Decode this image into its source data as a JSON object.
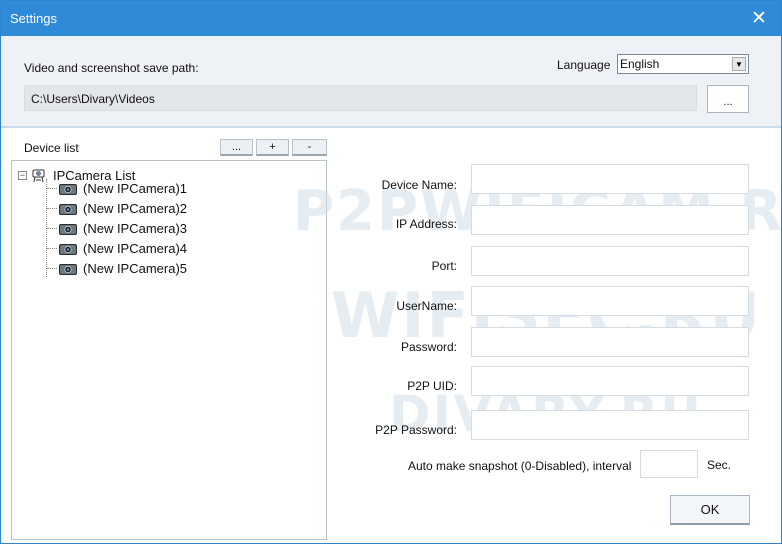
{
  "window": {
    "title": "Settings",
    "close_glyph": "✕"
  },
  "top": {
    "save_path_label": "Video and screenshot save path:",
    "language_label": "Language",
    "language_value": "English",
    "save_path_value": "C:\\Users\\Divary\\Videos",
    "browse_label": "..."
  },
  "device_list": {
    "label": "Device list",
    "buttons": {
      "more": "...",
      "add": "+",
      "remove": "-"
    },
    "root_label": "IPCamera List",
    "items": [
      {
        "label": "(New IPCamera)1"
      },
      {
        "label": "(New IPCamera)2"
      },
      {
        "label": "(New IPCamera)3"
      },
      {
        "label": "(New IPCamera)4"
      },
      {
        "label": "(New IPCamera)5"
      }
    ]
  },
  "form": {
    "device_name_label": "Device Name:",
    "ip_address_label": "IP Address:",
    "port_label": "Port:",
    "username_label": "UserName:",
    "password_label": "Password:",
    "p2p_uid_label": "P2P UID:",
    "p2p_password_label": "P2P Password:",
    "snapshot_label": "Auto make snapshot (0-Disabled), interval",
    "sec_label": "Sec.",
    "ok_label": "OK"
  },
  "watermarks": [
    "P2PWIFICAM.R",
    "WIFISEC.RU",
    "DIVARY.RU"
  ],
  "colors": {
    "titlebar": "#2f8bd8",
    "top_area": "#eef2f7",
    "watermark": "#d2dee8"
  },
  "icons": {
    "close": "close-icon",
    "dropdown": "chevron-down-icon",
    "root": "ipcamera-list-icon",
    "camera": "camera-icon"
  }
}
